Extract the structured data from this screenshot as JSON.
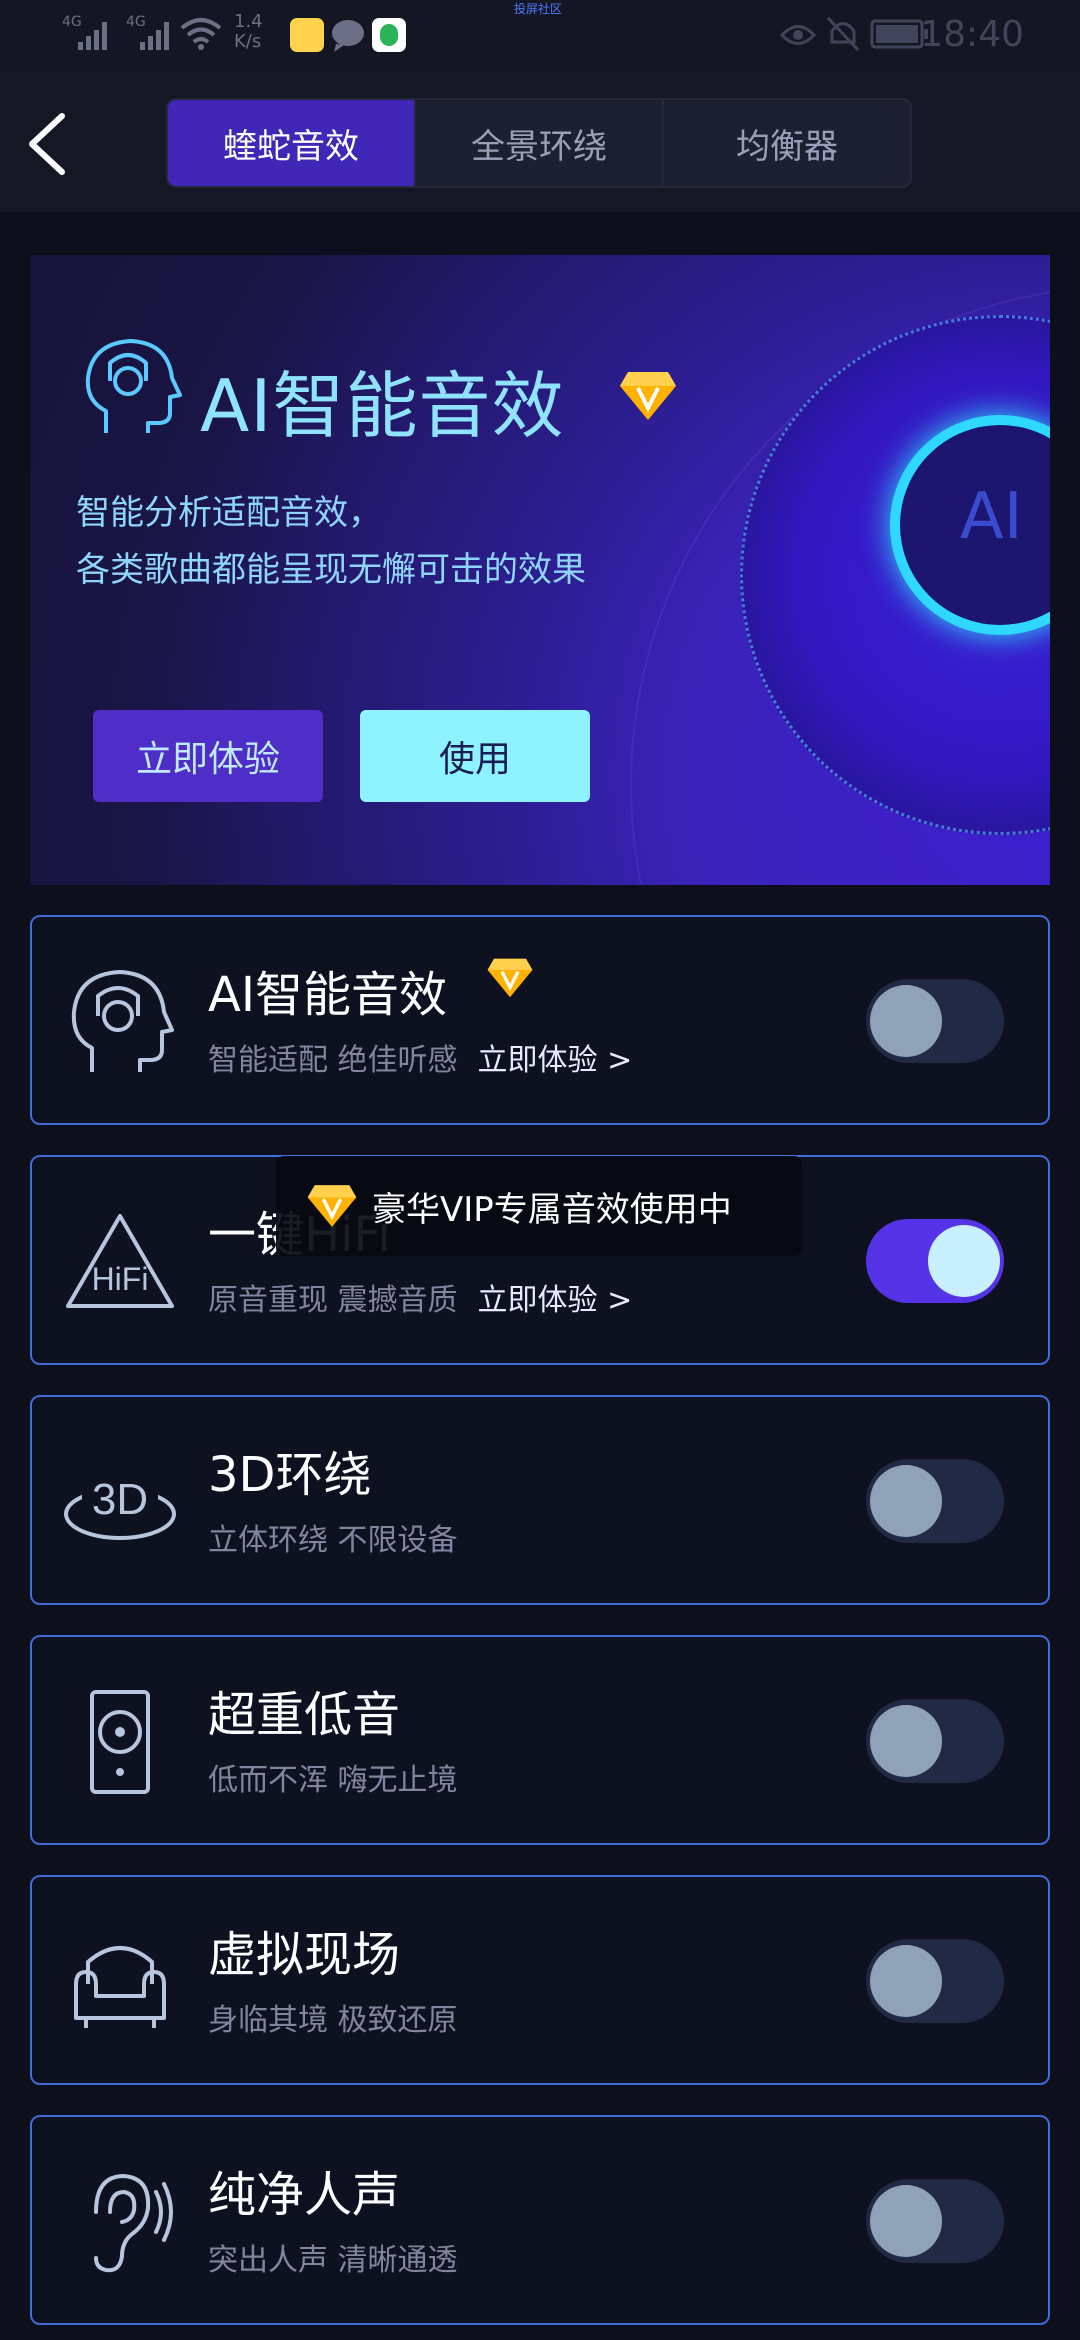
{
  "status_bar": {
    "signal_1": "4G",
    "signal_2": "4G",
    "speed": "1.4",
    "speed_unit": "K/s",
    "top_note": "投屏社区",
    "time": "18:40"
  },
  "header": {
    "tabs": [
      {
        "label": "蝰蛇音效",
        "active": true
      },
      {
        "label": "全景环绕",
        "active": false
      },
      {
        "label": "均衡器",
        "active": false
      }
    ]
  },
  "hero": {
    "title": "AI智能音效",
    "desc_line1": "智能分析适配音效，",
    "desc_line2": "各类歌曲都能呈现无懈可击的效果",
    "orb_label": "AI",
    "try_label": "立即体验",
    "use_label": "使用"
  },
  "toast": {
    "text": "豪华VIP专属音效使用中"
  },
  "cards": [
    {
      "title": "AI智能音效",
      "subtitle": "智能适配 绝佳听感",
      "link": "立即体验 >",
      "icon": "ai-head-icon",
      "vip": true,
      "on": false
    },
    {
      "title": "一键HiFi",
      "subtitle": "原音重现 震撼音质",
      "link": "立即体验 >",
      "icon": "hifi-icon",
      "icon_text": "HiFi",
      "vip": true,
      "on": true
    },
    {
      "title": "3D环绕",
      "subtitle": "立体环绕 不限设备",
      "link": "",
      "icon": "3d-icon",
      "icon_text": "3D",
      "vip": false,
      "on": false
    },
    {
      "title": "超重低音",
      "subtitle": "低而不浑 嗨无止境",
      "link": "",
      "icon": "speaker-icon",
      "vip": false,
      "on": false
    },
    {
      "title": "虚拟现场",
      "subtitle": "身临其境 极致还原",
      "link": "",
      "icon": "sofa-icon",
      "vip": false,
      "on": false
    },
    {
      "title": "纯净人声",
      "subtitle": "突出人声 清晰通透",
      "link": "",
      "icon": "ear-icon",
      "vip": false,
      "on": false
    }
  ],
  "colors": {
    "background": "#0d0f1c",
    "accent": "#4127b8",
    "card_border": "#3d6ed9",
    "toggle_on": "#5434e6",
    "cyan": "#8ef3ff",
    "vip_gold": "#ffb300"
  }
}
